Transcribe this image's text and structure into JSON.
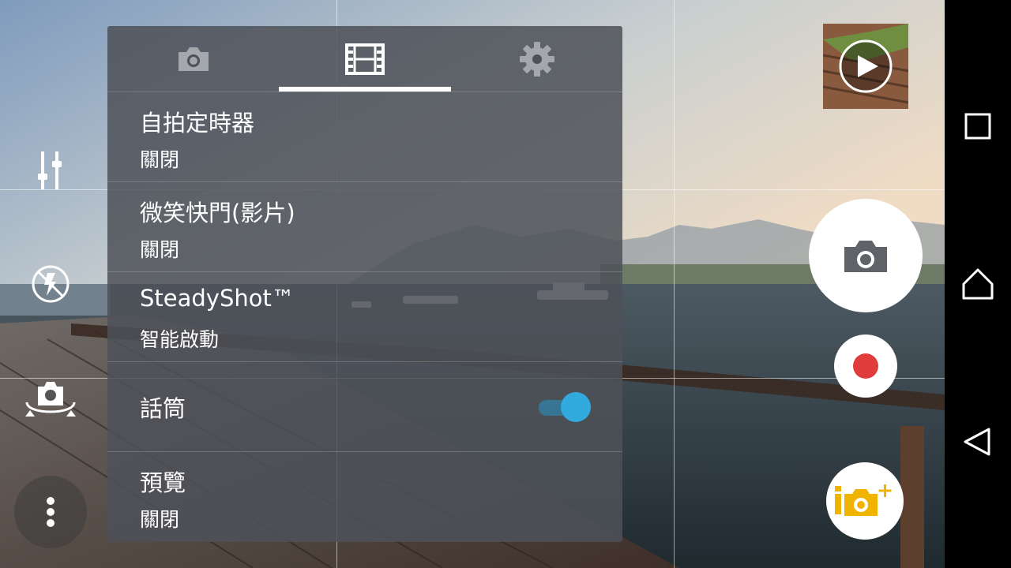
{
  "panel": {
    "tabs": [
      {
        "id": "photo",
        "icon": "camera-icon"
      },
      {
        "id": "video",
        "icon": "film-icon",
        "selected": true
      },
      {
        "id": "settings",
        "icon": "gear-icon"
      }
    ],
    "rows": [
      {
        "title": "自拍定時器",
        "value": "關閉"
      },
      {
        "title": "微笑快門(影片)",
        "value": "關閉"
      },
      {
        "title": "SteadyShot™",
        "value": "智能啟動"
      },
      {
        "title": "話筒",
        "toggle": true
      },
      {
        "title": "預覽",
        "value": "關閉"
      }
    ]
  },
  "left_controls": [
    "sliders-icon",
    "flash-auto-icon",
    "switch-camera-icon",
    "more-vertical-icon"
  ],
  "right_controls": [
    "gallery-thumbnail-play-icon",
    "camera-shutter-icon",
    "record-icon",
    "camera-modes-icon"
  ],
  "nav": [
    "recents-square-icon",
    "home-icon",
    "back-triangle-icon"
  ],
  "colors": {
    "accent": "#33aadd",
    "record": "#e03c3c",
    "modes_icon": "#f0b400"
  }
}
